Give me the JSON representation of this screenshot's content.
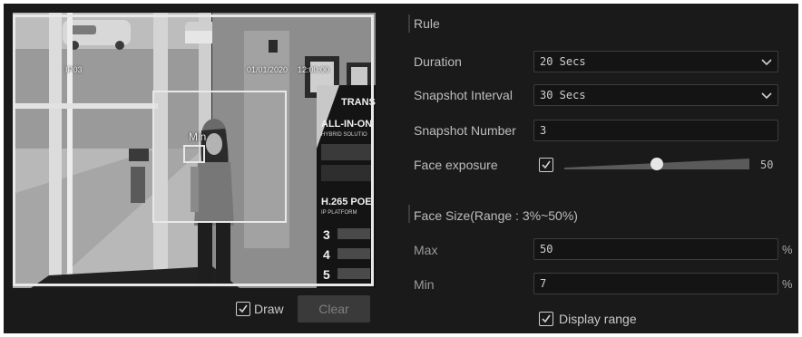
{
  "preview": {
    "camera_label": "IP03",
    "date": "01/01/2020",
    "time": "12:00:00",
    "min_box_label": "Min",
    "draw_label": "Draw",
    "draw_checked": true,
    "clear_label": "Clear"
  },
  "rule": {
    "title": "Rule",
    "duration": {
      "label": "Duration",
      "value": "20 Secs"
    },
    "snapshot_interval": {
      "label": "Snapshot Interval",
      "value": "30 Secs"
    },
    "snapshot_number": {
      "label": "Snapshot Number",
      "value": "3"
    },
    "face_exposure": {
      "label": "Face exposure",
      "checked": true,
      "value": "50",
      "fraction": 0.5
    }
  },
  "face_size": {
    "title": "Face Size(Range : 3%~50%)",
    "max": {
      "label": "Max",
      "value": "50",
      "unit": "%"
    },
    "min": {
      "label": "Min",
      "value": "7",
      "unit": "%"
    },
    "display_range": {
      "label": "Display range",
      "checked": true
    }
  }
}
